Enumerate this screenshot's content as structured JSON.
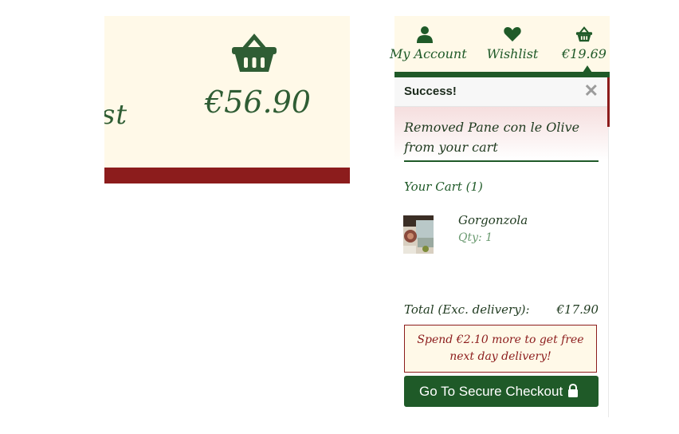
{
  "left_zoom": {
    "wishlist_partial": "ist",
    "cart_total": "€56.90",
    "basket_icon": "basket-icon"
  },
  "header": {
    "account_label": "My Account",
    "wishlist_label": "Wishlist",
    "cart_total": "€19.69",
    "icons": [
      "user-icon",
      "heart-icon",
      "basket-icon"
    ]
  },
  "toast": {
    "title": "Success!",
    "close": "✕",
    "message": "Removed Pane con le Olive from your cart"
  },
  "cart": {
    "heading": "Your Cart (1)",
    "items": [
      {
        "name": "Gorgonzola",
        "qty": "Qty: 1"
      }
    ],
    "total_label": "Total (Exc. delivery):",
    "total_value": "€17.90",
    "delivery_notice": "Spend €2.10 more to get free next day delivery!",
    "checkout_label": "Go To Secure Checkout"
  },
  "colors": {
    "brand_green": "#1f5a28",
    "brand_red": "#8c1c1c",
    "cream": "#fff9e8"
  }
}
